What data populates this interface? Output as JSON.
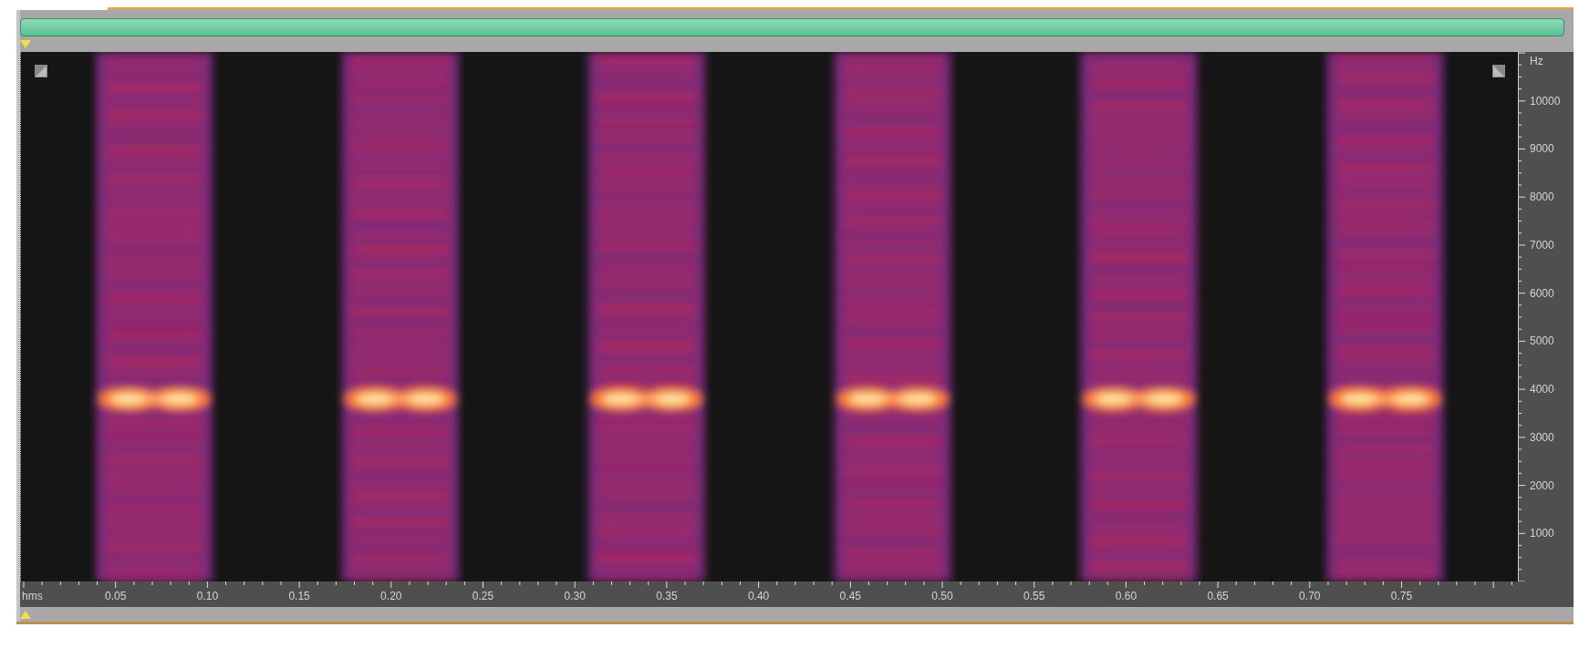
{
  "spectrogram": {
    "y_axis": {
      "unit": "Hz",
      "ticks": [
        "10000",
        "9000",
        "8000",
        "7000",
        "6000",
        "5000",
        "4000",
        "3000",
        "2000",
        "1000"
      ]
    },
    "x_axis": {
      "unit": "hms",
      "ticks": [
        "0.05",
        "0.10",
        "0.15",
        "0.20",
        "0.25",
        "0.30",
        "0.35",
        "0.40",
        "0.45",
        "0.50",
        "0.55",
        "0.60",
        "0.65",
        "0.70",
        "0.75"
      ]
    }
  }
}
